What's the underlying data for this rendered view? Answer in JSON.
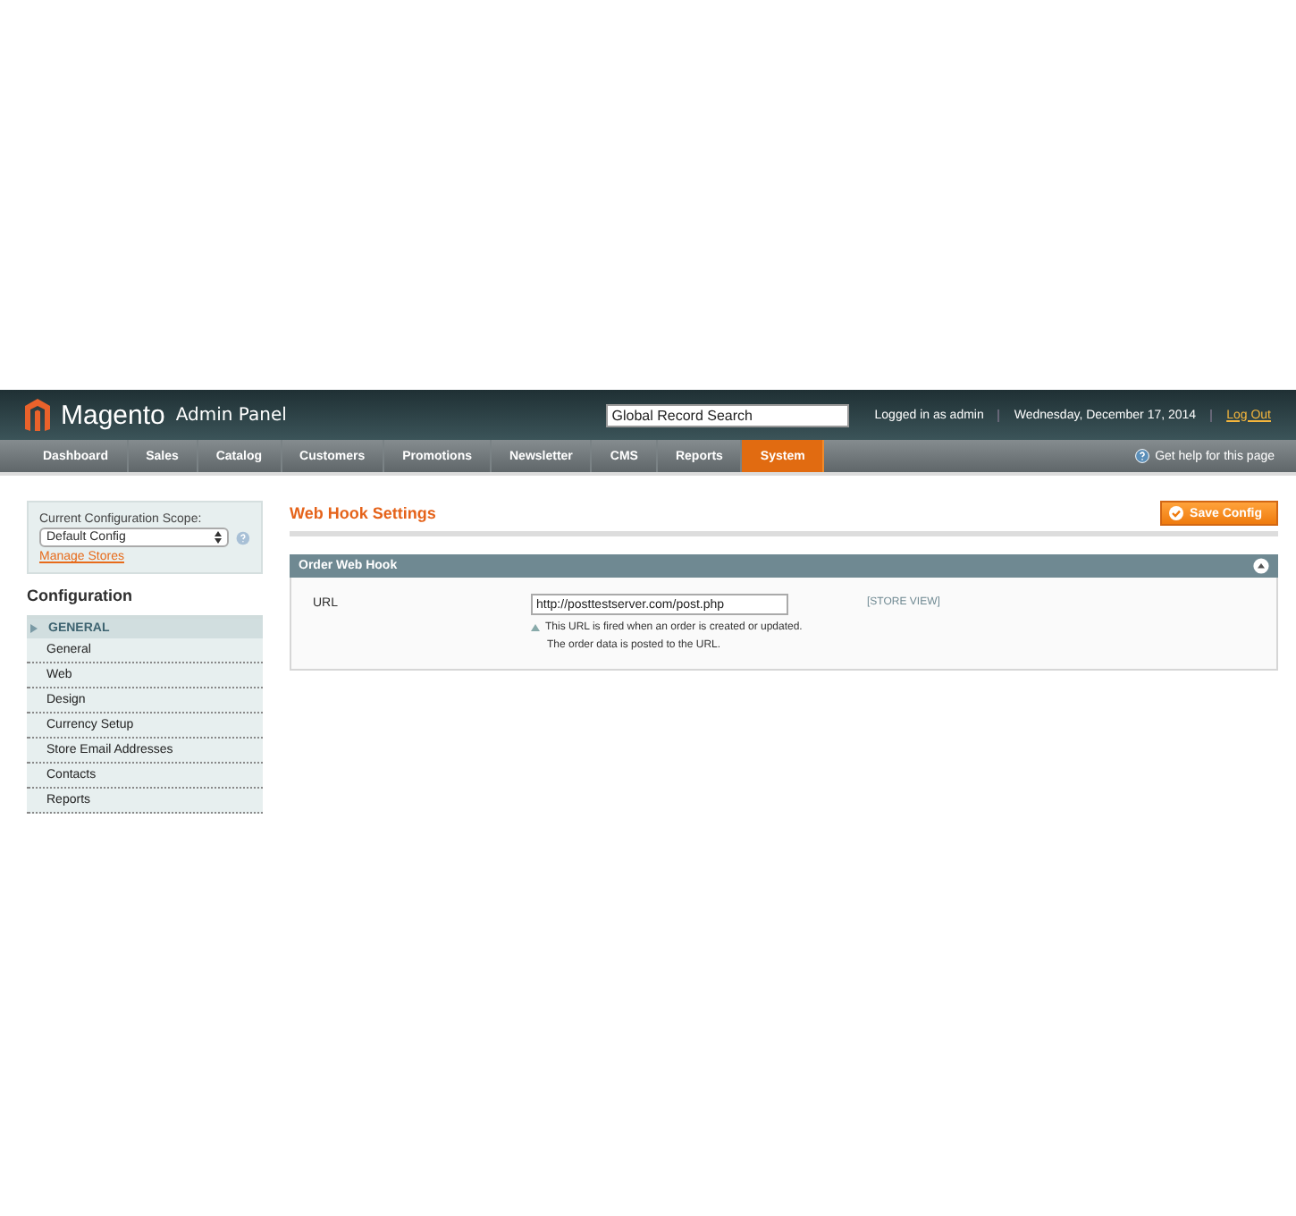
{
  "header": {
    "logo_text": "Magento",
    "logo_suffix": "Admin Panel",
    "search": {
      "placeholder": "Global Record Search"
    },
    "user_info": "Logged in as admin",
    "date": "Wednesday, December 17, 2014",
    "logout": "Log Out"
  },
  "nav": {
    "items": [
      {
        "label": "Dashboard",
        "selected": false
      },
      {
        "label": "Sales",
        "selected": false
      },
      {
        "label": "Catalog",
        "selected": false
      },
      {
        "label": "Customers",
        "selected": false
      },
      {
        "label": "Promotions",
        "selected": false
      },
      {
        "label": "Newsletter",
        "selected": false
      },
      {
        "label": "CMS",
        "selected": false
      },
      {
        "label": "Reports",
        "selected": false
      },
      {
        "label": "System",
        "selected": true
      }
    ],
    "help": "Get help for this page"
  },
  "sidebar": {
    "scope_label": "Current Configuration Scope:",
    "scope_value": "Default Config",
    "manage_stores": "Manage Stores",
    "title": "Configuration",
    "section": "GENERAL",
    "items": [
      {
        "label": "General"
      },
      {
        "label": "Web"
      },
      {
        "label": "Design"
      },
      {
        "label": "Currency Setup"
      },
      {
        "label": "Store Email Addresses"
      },
      {
        "label": "Contacts"
      },
      {
        "label": "Reports"
      }
    ]
  },
  "content": {
    "title": "Web Hook Settings",
    "save_button": "Save Config",
    "fieldset": {
      "title": "Order Web Hook",
      "expanded": true,
      "fields": [
        {
          "label": "URL",
          "value": "http://posttestserver.com/post.php",
          "scope": "[STORE VIEW]",
          "notes": [
            "This URL is fired when an order is created or updated.",
            "The order data is posted to the URL."
          ]
        }
      ]
    }
  }
}
